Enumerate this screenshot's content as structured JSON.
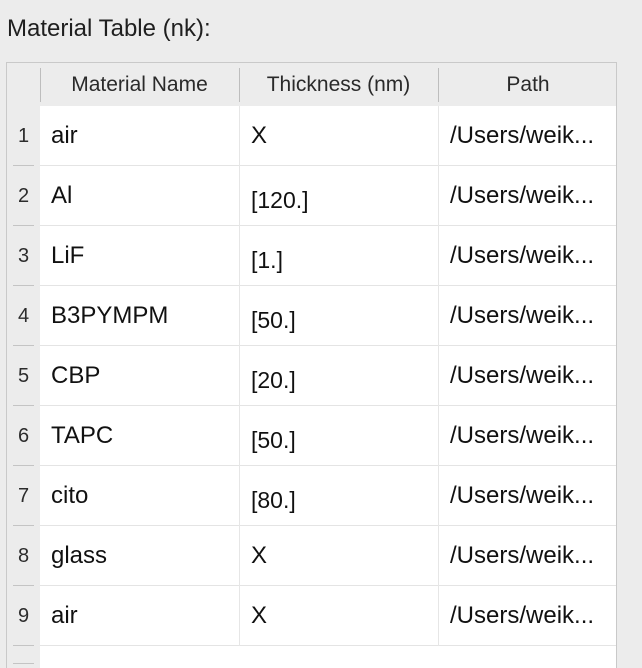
{
  "section_title": "Material Table (nk):",
  "table": {
    "columns": [
      "Material Name",
      "Thickness (nm)",
      "Path"
    ],
    "rows": [
      {
        "index": "1",
        "name": "air",
        "thickness": "X",
        "path": "/Users/weik..."
      },
      {
        "index": "2",
        "name": "Al",
        "thickness": "[120.]",
        "path": "/Users/weik..."
      },
      {
        "index": "3",
        "name": "LiF",
        "thickness": "[1.]",
        "path": "/Users/weik..."
      },
      {
        "index": "4",
        "name": "B3PYMPM",
        "thickness": "[50.]",
        "path": "/Users/weik..."
      },
      {
        "index": "5",
        "name": "CBP",
        "thickness": "[20.]",
        "path": "/Users/weik..."
      },
      {
        "index": "6",
        "name": "TAPC",
        "thickness": "[50.]",
        "path": "/Users/weik..."
      },
      {
        "index": "7",
        "name": "cito",
        "thickness": "[80.]",
        "path": "/Users/weik..."
      },
      {
        "index": "8",
        "name": "glass",
        "thickness": "X",
        "path": "/Users/weik..."
      },
      {
        "index": "9",
        "name": "air",
        "thickness": "X",
        "path": "/Users/weik..."
      }
    ]
  }
}
